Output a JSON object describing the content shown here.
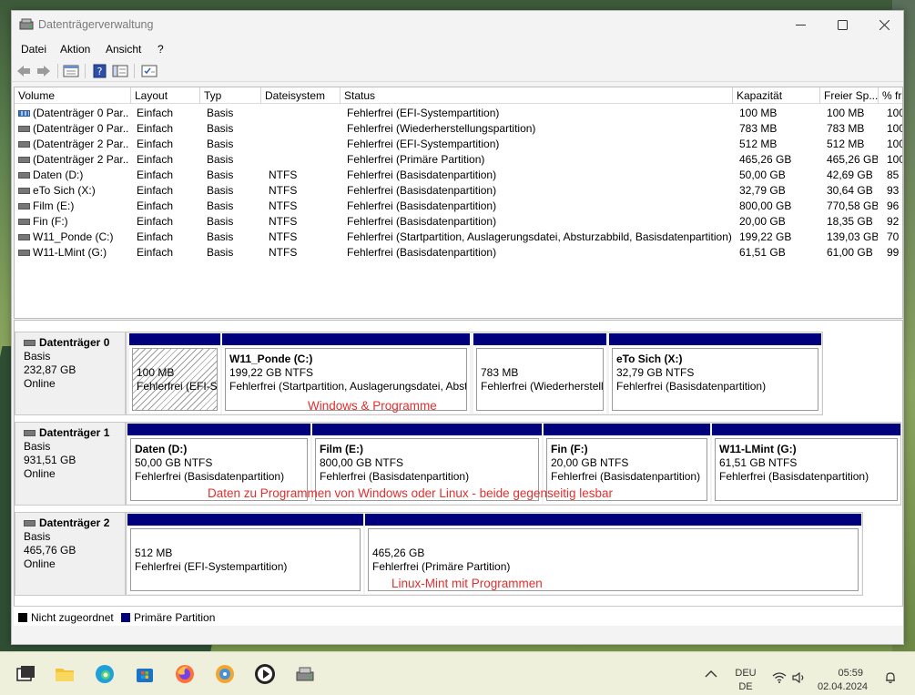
{
  "window": {
    "title": "Datenträgerverwaltung"
  },
  "menu": [
    "Datei",
    "Aktion",
    "Ansicht",
    "?"
  ],
  "toolbar": [
    "back-icon",
    "forward-icon",
    "properties-icon",
    "help-icon",
    "console-icon",
    "rescan-icon"
  ],
  "volume_list": {
    "columns": [
      "Volume",
      "Layout",
      "Typ",
      "Dateisystem",
      "Status",
      "Kapazität",
      "Freier Sp...",
      "% fr"
    ],
    "rows": [
      {
        "icon": "efi",
        "volume": "(Datenträger 0 Par...",
        "layout": "Einfach",
        "type": "Basis",
        "fs": "",
        "status": "Fehlerfrei (EFI-Systempartition)",
        "cap": "100 MB",
        "free": "100 MB",
        "pct": "100"
      },
      {
        "icon": "disk",
        "volume": "(Datenträger 0 Par...",
        "layout": "Einfach",
        "type": "Basis",
        "fs": "",
        "status": "Fehlerfrei (Wiederherstellungspartition)",
        "cap": "783 MB",
        "free": "783 MB",
        "pct": "100"
      },
      {
        "icon": "disk",
        "volume": "(Datenträger 2 Par...",
        "layout": "Einfach",
        "type": "Basis",
        "fs": "",
        "status": "Fehlerfrei (EFI-Systempartition)",
        "cap": "512 MB",
        "free": "512 MB",
        "pct": "100"
      },
      {
        "icon": "disk",
        "volume": "(Datenträger 2 Par...",
        "layout": "Einfach",
        "type": "Basis",
        "fs": "",
        "status": "Fehlerfrei (Primäre Partition)",
        "cap": "465,26 GB",
        "free": "465,26 GB",
        "pct": "100"
      },
      {
        "icon": "disk",
        "volume": "Daten (D:)",
        "layout": "Einfach",
        "type": "Basis",
        "fs": "NTFS",
        "status": "Fehlerfrei (Basisdatenpartition)",
        "cap": "50,00 GB",
        "free": "42,69 GB",
        "pct": "85 %"
      },
      {
        "icon": "disk",
        "volume": "eTo Sich (X:)",
        "layout": "Einfach",
        "type": "Basis",
        "fs": "NTFS",
        "status": "Fehlerfrei (Basisdatenpartition)",
        "cap": "32,79 GB",
        "free": "30,64 GB",
        "pct": "93 %"
      },
      {
        "icon": "disk",
        "volume": "Film (E:)",
        "layout": "Einfach",
        "type": "Basis",
        "fs": "NTFS",
        "status": "Fehlerfrei (Basisdatenpartition)",
        "cap": "800,00 GB",
        "free": "770,58 GB",
        "pct": "96 %"
      },
      {
        "icon": "disk",
        "volume": "Fin (F:)",
        "layout": "Einfach",
        "type": "Basis",
        "fs": "NTFS",
        "status": "Fehlerfrei (Basisdatenpartition)",
        "cap": "20,00 GB",
        "free": "18,35 GB",
        "pct": "92 %"
      },
      {
        "icon": "disk",
        "volume": "W11_Ponde (C:)",
        "layout": "Einfach",
        "type": "Basis",
        "fs": "NTFS",
        "status": "Fehlerfrei (Startpartition, Auslagerungsdatei, Absturzabbild, Basisdatenpartition)",
        "cap": "199,22 GB",
        "free": "139,03 GB",
        "pct": "70 %"
      },
      {
        "icon": "disk",
        "volume": "W11-LMint (G:)",
        "layout": "Einfach",
        "type": "Basis",
        "fs": "NTFS",
        "status": "Fehlerfrei (Basisdatenpartition)",
        "cap": "61,51 GB",
        "free": "61,00 GB",
        "pct": "99 %"
      }
    ]
  },
  "disks": [
    {
      "name": "Datenträger 0",
      "type": "Basis",
      "size": "232,87 GB",
      "state": "Online",
      "partitions": [
        {
          "title": "",
          "size": "100 MB",
          "status": "Fehlerfrei (EFI-Sy",
          "hatched": true
        },
        {
          "title": "W11_Ponde  (C:)",
          "size": "199,22 GB NTFS",
          "status": "Fehlerfrei (Startpartition, Auslagerungsdatei, Abst"
        },
        {
          "title": "",
          "size": "783 MB",
          "status": "Fehlerfrei (Wiederherstellu"
        },
        {
          "title": "eTo Sich  (X:)",
          "size": "32,79 GB NTFS",
          "status": "Fehlerfrei (Basisdatenpartition)"
        }
      ],
      "note": "Windows & Programme"
    },
    {
      "name": "Datenträger 1",
      "type": "Basis",
      "size": "931,51 GB",
      "state": "Online",
      "partitions": [
        {
          "title": "Daten  (D:)",
          "size": "50,00 GB NTFS",
          "status": "Fehlerfrei (Basisdatenpartition)"
        },
        {
          "title": "Film  (E:)",
          "size": "800,00 GB NTFS",
          "status": "Fehlerfrei (Basisdatenpartition)"
        },
        {
          "title": "Fin  (F:)",
          "size": "20,00 GB NTFS",
          "status": "Fehlerfrei (Basisdatenpartition)"
        },
        {
          "title": "W11-LMint  (G:)",
          "size": "61,51 GB NTFS",
          "status": "Fehlerfrei (Basisdatenpartition)"
        }
      ],
      "note": "Daten zu Programmen von Windows oder Linux - beide gegenseitig lesbar"
    },
    {
      "name": "Datenträger 2",
      "type": "Basis",
      "size": "465,76 GB",
      "state": "Online",
      "partitions": [
        {
          "title": "",
          "size": "512 MB",
          "status": "Fehlerfrei (EFI-Systempartition)"
        },
        {
          "title": "",
          "size": "465,26 GB",
          "status": "Fehlerfrei (Primäre Partition)"
        }
      ],
      "note": "Linux-Mint mit Programmen"
    }
  ],
  "legend": [
    {
      "label": "Nicht zugeordnet",
      "color": "#000000"
    },
    {
      "label": "Primäre Partition",
      "color": "#00007d"
    }
  ],
  "taskbar": {
    "apps": [
      "show-desktop-icon",
      "file-explorer-icon",
      "edge-icon",
      "store-icon",
      "firefox-icon",
      "app-icon",
      "media-player-icon",
      "disk-management-icon"
    ],
    "lang1": "DEU",
    "lang2": "DE",
    "time": "05:59",
    "date": "02.04.2024"
  }
}
